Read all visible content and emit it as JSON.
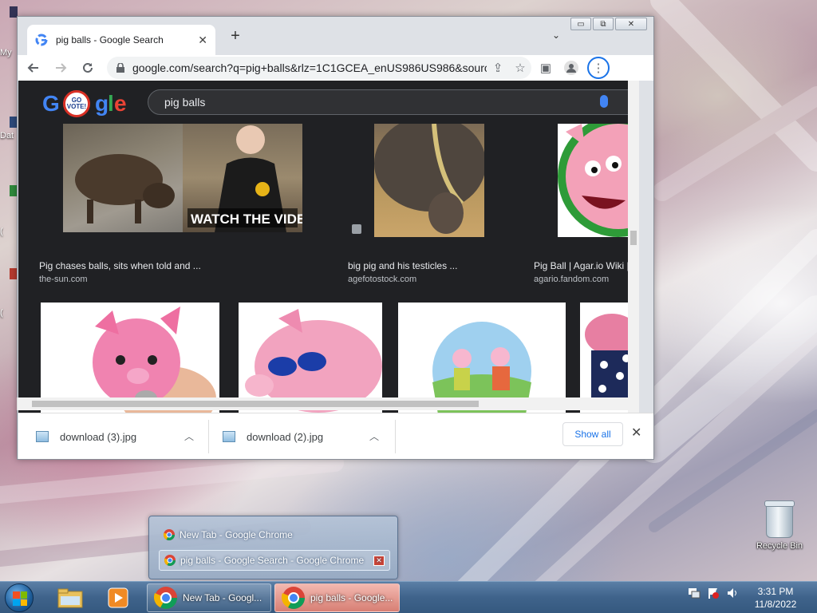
{
  "desktop": {
    "edge_labels": [
      "My",
      "Dat",
      "(",
      "("
    ],
    "recycle_bin_label": "Recycle Bin"
  },
  "browser": {
    "tab": {
      "title": "pig balls - Google Search"
    },
    "new_tab_symbol": "+",
    "url": "google.com/search?q=pig+balls&rlz=1C1GCEA_enUS986US986&source=l...",
    "caption_buttons": {
      "minimize": "▭",
      "restore": "⧉",
      "close": "✕"
    }
  },
  "google": {
    "logo_text": "Google",
    "doodle_text": "GO VOTE!",
    "query": "pig balls",
    "results": [
      {
        "caption": "Pig chases balls, sits when told and ...",
        "source": "the-sun.com",
        "overlay": "WATCH THE VIDEO"
      },
      {
        "caption": "big pig and his testicles ...",
        "source": "agefotostock.com"
      },
      {
        "caption": "Pig Ball | Agar.io Wiki | F",
        "source": "agario.fandom.com"
      }
    ]
  },
  "downloads": {
    "items": [
      {
        "name": "download (3).jpg"
      },
      {
        "name": "download (2).jpg"
      }
    ],
    "show_all_label": "Show all"
  },
  "taskbar_popup": {
    "items": [
      {
        "label": "New Tab - Google Chrome"
      },
      {
        "label": "pig balls - Google Search - Google Chrome"
      }
    ]
  },
  "taskbar": {
    "tasks": [
      {
        "label": "New Tab - Googl..."
      },
      {
        "label": "pig balls - Google..."
      }
    ],
    "clock": {
      "time": "3:31 PM",
      "date": "11/8/2022"
    }
  },
  "colors": {
    "google_blue": "#4285f4",
    "google_red": "#ea4335",
    "google_yellow": "#fbbc05",
    "google_green": "#34a853",
    "chrome_accent": "#1a73e8"
  }
}
